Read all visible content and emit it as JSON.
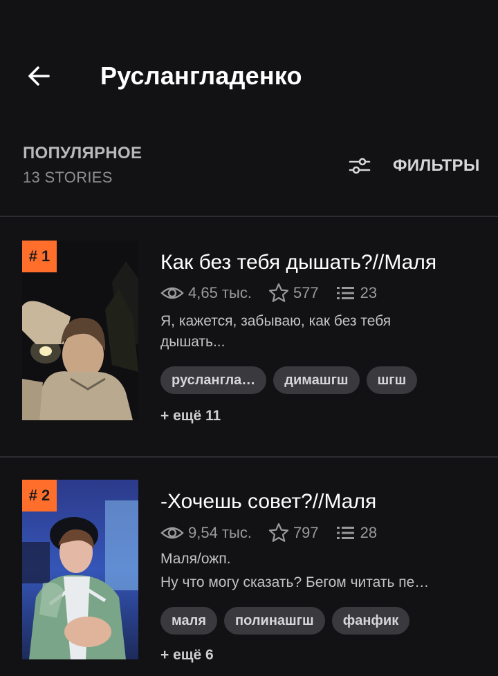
{
  "header": {
    "title": "Руслангладенко"
  },
  "list_header": {
    "sort_label": "ПОПУЛЯРНОЕ",
    "count_label": "13 STORIES",
    "filter_label": "ФИЛЬТРЫ"
  },
  "stories": [
    {
      "rank": "# 1",
      "title": "Как без тебя дышать?//Маля",
      "reads": "4,65 тыс.",
      "votes": "577",
      "parts": "23",
      "description_lines": [
        "Я, кажется, забываю, как без тебя",
        "дышать..."
      ],
      "tags": [
        "русланглa…",
        "димашгш",
        "шгш"
      ],
      "more_tags": "+ ещё 11"
    },
    {
      "rank": "# 2",
      "title": "-Хочешь совет?//Маля",
      "reads": "9,54 тыс.",
      "votes": "797",
      "parts": "28",
      "description_lines": [
        "Маля/ожп.",
        "Ну что могу сказать? Бегом читать пе…"
      ],
      "tags": [
        "маля",
        "полинашгш",
        "фанфик"
      ],
      "more_tags": "+ ещё 6"
    }
  ],
  "colors": {
    "background": "#121113",
    "rank_badge": "#ff6f2b",
    "tag_bg": "#3a393d"
  },
  "icons": {
    "back": "arrow-left-icon",
    "filter": "sliders-icon",
    "reads": "eye-icon",
    "votes": "star-icon",
    "parts": "list-icon"
  }
}
